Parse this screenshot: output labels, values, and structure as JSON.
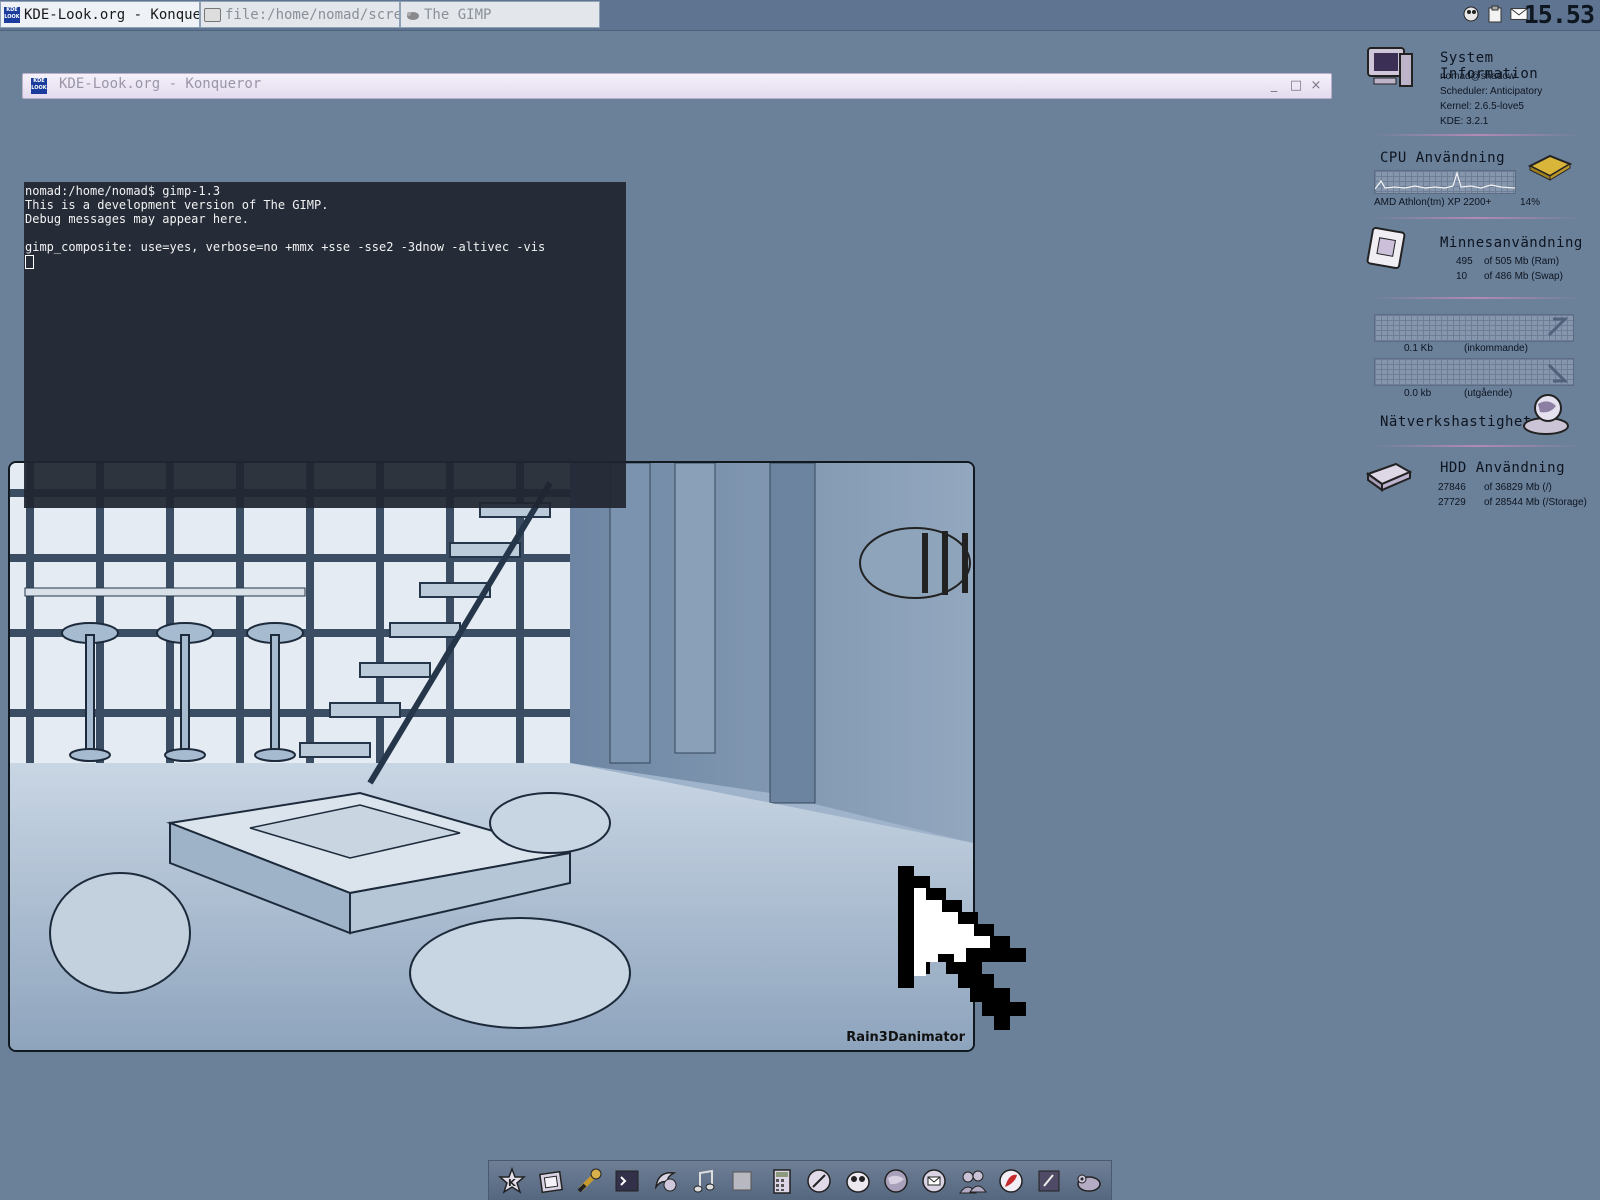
{
  "taskbar": {
    "tasks": [
      {
        "label": "KDE-Look.org - Konqueror",
        "active": true,
        "icon": "kde-look-icon"
      },
      {
        "label": "file:/home/nomad/screenshots",
        "active": false,
        "icon": "folder-icon"
      },
      {
        "label": "The GIMP",
        "active": false,
        "icon": "gimp-icon"
      }
    ],
    "tray_icons": [
      "kopete-icon",
      "klipper-icon",
      "mail-icon"
    ],
    "clock": "15.53"
  },
  "konqueror_window": {
    "title": "KDE-Look.org - Konqueror",
    "logo_text": "KDE LOOK",
    "buttons": {
      "minimize": "_",
      "maximize": "□",
      "close": "×"
    }
  },
  "terminal": {
    "lines": [
      "nomad:/home/nomad$ gimp-1.3",
      "This is a development version of The GIMP.",
      "Debug messages may appear here.",
      "",
      "gimp_composite: use=yes, verbose=no +mmx +sse -sse2 -3dnow -altivec -vis"
    ]
  },
  "wallpaper": {
    "signature": "Rain3Danimator"
  },
  "sysmon": {
    "system_info": {
      "title": "System Information",
      "user": "nomad@shadow",
      "scheduler": "Scheduler: Anticipatory",
      "kernel": "Kernel: 2.6.5-love5",
      "kde": "KDE: 3.2.1"
    },
    "cpu": {
      "title": "CPU Användning",
      "model": "AMD Athlon(tm) XP 2200+",
      "usage": "14%"
    },
    "memory": {
      "title": "Minnesanvändning",
      "ram_used": "495",
      "ram_total": "of 505 Mb (Ram)",
      "swap_used": "10",
      "swap_total": "of 486 Mb (Swap)"
    },
    "network": {
      "title": "Nätverkshastighet",
      "in_value": "0.1 Kb",
      "in_label": "(inkommande)",
      "out_value": "0.0 kb",
      "out_label": "(utgående)"
    },
    "hdd": {
      "title": "HDD Användning",
      "root_used": "27846",
      "root_total": "of 36829 Mb (/)",
      "storage_used": "27729",
      "storage_total": "of 28544 Mb (/Storage)"
    }
  },
  "dock": {
    "icons": [
      "kde-menu-icon",
      "home-folder-icon",
      "control-center-icon",
      "konsole-icon",
      "konqueror-icon",
      "music-icon",
      "blank-window-icon",
      "calculator-icon",
      "editor-icon",
      "kopete-icon",
      "web-browser-icon",
      "kmail-icon",
      "users-icon",
      "media-player-icon",
      "terminal-icon",
      "gimp-icon"
    ]
  },
  "colors": {
    "desktop": "#6b819a",
    "terminal_bg": "#202630",
    "accent": "#b38ab4"
  }
}
